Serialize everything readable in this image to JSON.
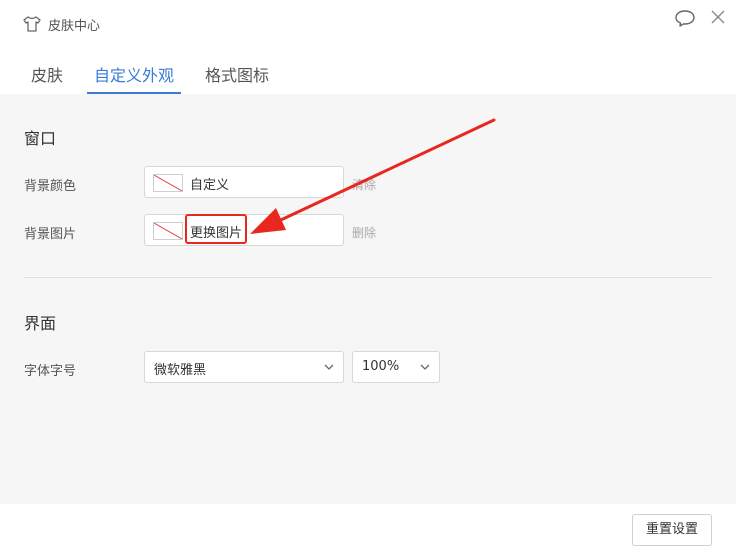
{
  "window": {
    "title": "皮肤中心"
  },
  "tabs": [
    {
      "label": "皮肤"
    },
    {
      "label": "自定义外观"
    },
    {
      "label": "格式图标"
    }
  ],
  "window_section": {
    "title": "窗口",
    "background_color": {
      "label": "背景颜色",
      "value": "自定义",
      "action": "清除"
    },
    "background_image": {
      "label": "背景图片",
      "value": "更换图片",
      "action": "删除"
    }
  },
  "interface_section": {
    "title": "界面",
    "font": {
      "label": "字体字号",
      "family": "微软雅黑",
      "size": "100%"
    }
  },
  "footer": {
    "reset_label": "重置设置"
  },
  "colors": {
    "accent": "#3a7bd5",
    "annotation": "#e8271f",
    "panel_bg": "#f6f6f6"
  }
}
